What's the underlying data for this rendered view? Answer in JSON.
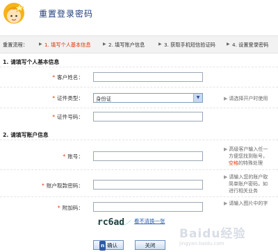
{
  "header": {
    "title": "重置登录密码"
  },
  "steps": {
    "label": "重置流程：",
    "items": [
      "1. 填写个人基本信息",
      "2. 填写账户信息",
      "3. 获取手机短信验证码",
      "4. 设置登录密码"
    ],
    "active_index": 0
  },
  "section1": {
    "title": "1. 请填写个人基本信息",
    "fields": {
      "name_label": "客户姓名：",
      "id_type_label": "证件类型：",
      "id_type_value": "身份证",
      "id_type_hint": "请选择开户时使用",
      "id_number_label": "证件号码："
    }
  },
  "section2": {
    "title": "2. 请填写账户信息",
    "fields": {
      "account_label": "账号：",
      "account_hint_1": "高级客户输入任一",
      "account_hint_2": "方便您找到账号，",
      "account_hint_3": "空格",
      "account_hint_3b": "的特殊处理",
      "password_label": "账户取款密码：",
      "password_hint_1": "请输入您的账户取",
      "password_hint_2": "简单账户密码，如",
      "password_hint_3": "进行相关业务",
      "code_label": "附加码：",
      "code_hint": "请输入图片中的字",
      "captcha_text": "rc6ad",
      "refresh_label": "看不清换一张"
    }
  },
  "actions": {
    "confirm_label": "确认",
    "close_label": "关闭"
  },
  "watermark": {
    "text": "Baidu经验",
    "sub": "jingyan.baidu.com"
  },
  "colors": {
    "accent": "#e03200",
    "title": "#1f3f7c",
    "link": "#2a5db0"
  }
}
